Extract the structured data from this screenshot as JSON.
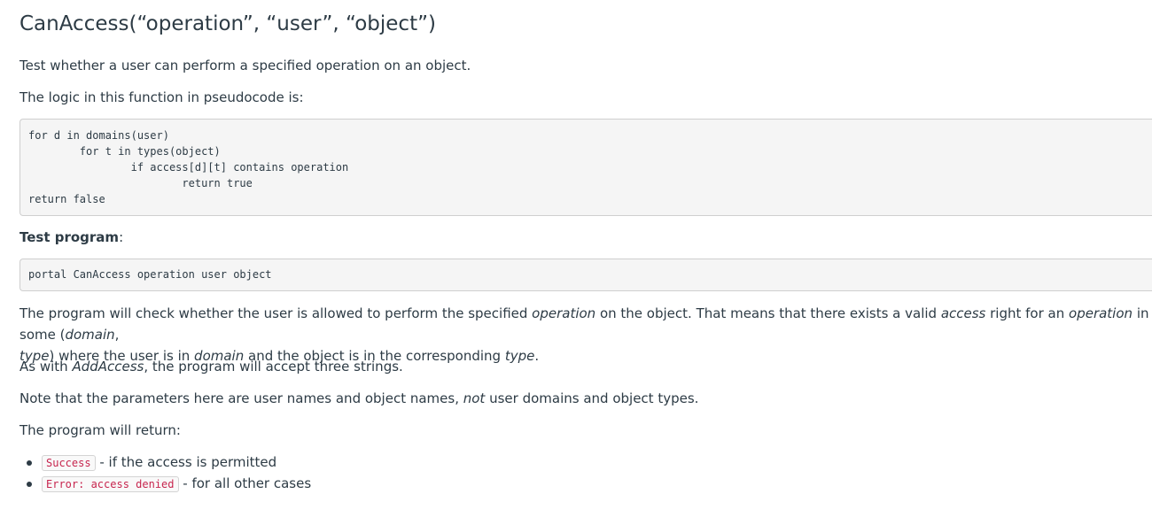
{
  "title": "CanAccess(“operation”, “user”, “object”)",
  "intro": "Test whether a user can perform a specified operation on an object.",
  "logic_intro": "The logic in this function in pseudocode is:",
  "pseudocode": [
    "for d in domains(user)",
    "        for t in types(object)",
    "                if access[d][t] contains operation",
    "                        return true",
    "return false"
  ],
  "test_program_label": "Test program",
  "test_program_colon": ":",
  "test_command": "portal CanAccess operation user object",
  "check_paragraph": {
    "p1": "The program will check whether the user is allowed to perform the specified ",
    "e1": "operation",
    "p2": " on the object. That means that there exists a valid ",
    "e2": "access",
    "p3": " right for an ",
    "e3": "operation",
    "p4": " in some (",
    "e4": "domain",
    "p5": ", ",
    "e5": "type",
    "p6": ") where the user is in ",
    "e6": "domain",
    "p7": " and the object is in the corresponding ",
    "e7": "type",
    "p8": "."
  },
  "addaccess_paragraph": {
    "p1": "As with ",
    "e1": "AddAccess",
    "p2": ", the program will accept three strings."
  },
  "note_paragraph": {
    "p1": "Note that the parameters here are user names and object names, ",
    "e1": "not",
    "p2": " user domains and object types."
  },
  "return_intro": "The program will return:",
  "results": [
    {
      "code": "Success",
      "text": " - if the access is permitted"
    },
    {
      "code": "Error: access denied",
      "text": " - for all other cases"
    }
  ]
}
